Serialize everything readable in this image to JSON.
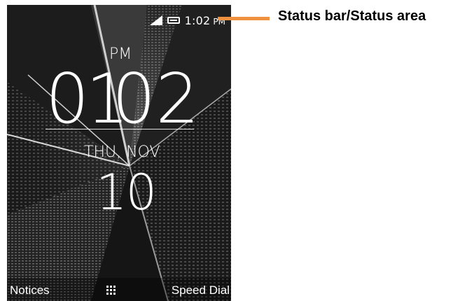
{
  "status_bar": {
    "icons": [
      "signal-icon",
      "battery-icon"
    ],
    "time": "1:02",
    "ampm": "PM"
  },
  "clock": {
    "ampm": "PM",
    "hour": "01",
    "minute": "02"
  },
  "date": {
    "weekday_month": "THU, NOV",
    "day": "10"
  },
  "softkeys": {
    "left": "Notices",
    "center_icon": "apps-grid-icon",
    "right": "Speed Dial"
  },
  "annotation": {
    "label": "Status bar/Status area",
    "line_color": "#f0913f"
  }
}
